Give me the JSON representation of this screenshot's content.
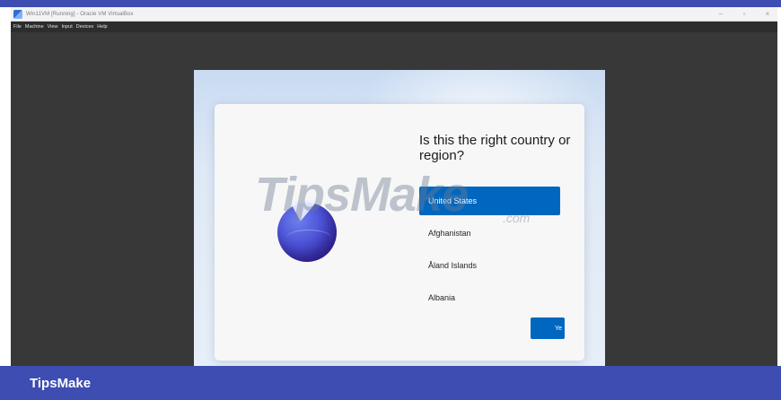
{
  "vbox": {
    "title": "Win11VM [Running] - Oracle VM VirtualBox",
    "menu": [
      "File",
      "Machine",
      "View",
      "Input",
      "Devices",
      "Help"
    ],
    "controls": {
      "minimize": "–",
      "restore": "▫",
      "close": "×"
    }
  },
  "oobe": {
    "question": "Is this the right country or region?",
    "countries": [
      {
        "label": "United States",
        "selected": true
      },
      {
        "label": "Afghanistan",
        "selected": false
      },
      {
        "label": "Åland Islands",
        "selected": false
      },
      {
        "label": "Albania",
        "selected": false
      }
    ],
    "yes_label": "Ye"
  },
  "watermark": {
    "main": "TipsMake",
    "suffix": ".com"
  },
  "brand": {
    "name": "TipsMake"
  },
  "colors": {
    "accent": "#3d4db2",
    "selected": "#0067c0",
    "vm_bg": "#383838"
  }
}
